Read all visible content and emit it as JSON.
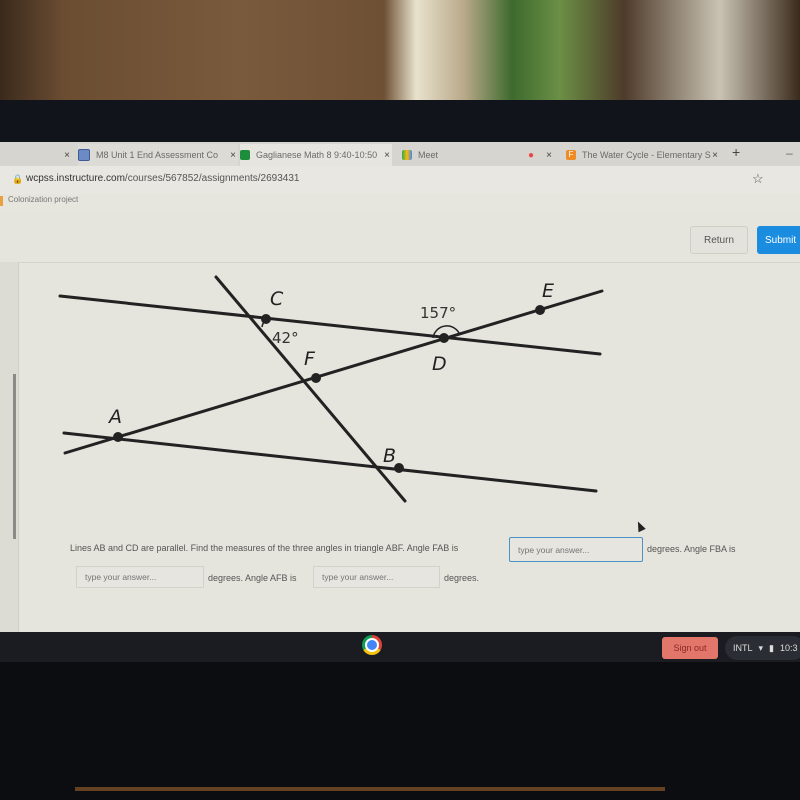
{
  "browser": {
    "tabs": [
      {
        "label": "",
        "icon": "blank-tab-icon",
        "close": "×"
      },
      {
        "label": "M8 Unit 1 End Assessment Co",
        "icon": "canvas-quiz-icon",
        "close": "×"
      },
      {
        "label": "Gaglianese Math 8 9:40-10:50",
        "icon": "google-classroom-icon",
        "close": "×"
      },
      {
        "label": "Meet",
        "icon": "google-meet-icon",
        "recording_indicator": "●",
        "close": "×"
      },
      {
        "label": "The Water Cycle - Elementary S",
        "icon": "flocabulary-icon",
        "close": "×"
      }
    ],
    "new_tab": "+",
    "minimize": "–",
    "url_domain": "wcpss.instructure.com",
    "url_path": "/courses/567852/assignments/2693431",
    "star": "☆",
    "bookmark": "Colonization project"
  },
  "page": {
    "return_label": "Return",
    "submit_label": "Submit",
    "diagram": {
      "points": [
        "A",
        "B",
        "C",
        "D",
        "E",
        "F"
      ],
      "angle_c": "42°",
      "angle_d": "157°"
    },
    "question": {
      "line1_text": "Lines AB and CD are parallel. Find the measures of the three angles in triangle ABF. Angle FAB is",
      "line1_after": "degrees. Angle FBA is",
      "line2_after1": "degrees. Angle AFB is",
      "line2_after2": "degrees.",
      "placeholder": "type your answer..."
    }
  },
  "shelf": {
    "signout_label": "Sign out",
    "ime": "INTL",
    "time": "10:3"
  },
  "colors": {
    "submit": "#1b8de0",
    "signout": "#e2766b",
    "focus_border": "#4b92c6"
  }
}
